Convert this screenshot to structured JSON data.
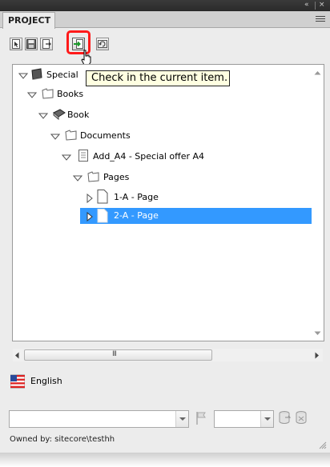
{
  "panel": {
    "tab_label": "PROJECT",
    "top_controls": "« | ×"
  },
  "toolbar": {
    "buttons": [
      {
        "icon": "document-select-icon",
        "tooltip": ""
      },
      {
        "icon": "save-icon",
        "tooltip": ""
      },
      {
        "icon": "check-out-icon",
        "tooltip": ""
      },
      {
        "icon": "check-in-icon",
        "tooltip": "Check in the current item."
      },
      {
        "icon": "refresh-icon",
        "tooltip": ""
      }
    ],
    "tooltip_text": "Check in the current item."
  },
  "tree": {
    "items": [
      {
        "label": "Special",
        "depth": 0,
        "expanded": true,
        "icon": "book-dark-icon"
      },
      {
        "label": "Books",
        "depth": 1,
        "expanded": true,
        "icon": "folder-icon"
      },
      {
        "label": "Book",
        "depth": 2,
        "expanded": true,
        "icon": "book-icon"
      },
      {
        "label": "Documents",
        "depth": 3,
        "expanded": true,
        "icon": "folder-icon"
      },
      {
        "label": "Add_A4 - Special offer A4",
        "depth": 4,
        "expanded": true,
        "icon": "document-lines-icon"
      },
      {
        "label": "Pages",
        "depth": 5,
        "expanded": true,
        "icon": "folder-icon"
      },
      {
        "label": "1-A - Page",
        "depth": 6,
        "expanded": false,
        "icon": "page-icon"
      },
      {
        "label": "2-A - Page",
        "depth": 6,
        "expanded": false,
        "icon": "page-icon",
        "selected": true
      }
    ],
    "h_scroll_grip": "III"
  },
  "language": {
    "label": "English",
    "flag": "us-flag-icon"
  },
  "footer": {
    "owned_by": "Owned by: sitecore\\testhh",
    "combo_left_value": "",
    "combo_right_value": ""
  },
  "colors": {
    "selection": "#3399ff",
    "tooltip_bg": "#ffffe1",
    "highlight_box": "#ff1a1a",
    "panel_bg": "#ececec"
  }
}
